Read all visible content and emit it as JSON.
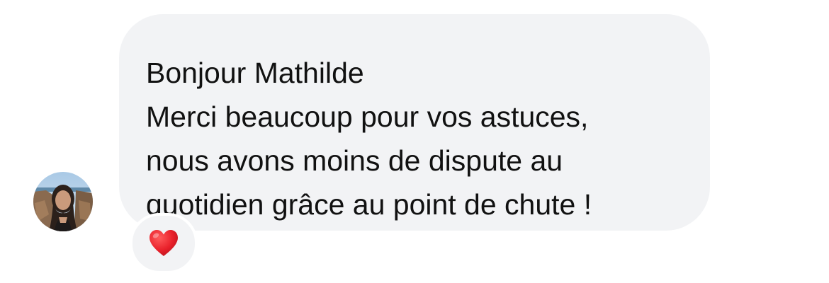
{
  "message": {
    "greeting": "Bonjour Mathilde",
    "lines": [
      "Merci beaucoup pour vos astuces,",
      "nous avons moins de dispute au",
      "quotidien grâce au point de chute !"
    ],
    "bubble_color": "#f2f3f5",
    "text_color": "#111111"
  },
  "reaction": {
    "icon": "red-heart-icon",
    "color": "#e8202a"
  },
  "sender": {
    "avatar_icon": "profile-photo"
  }
}
